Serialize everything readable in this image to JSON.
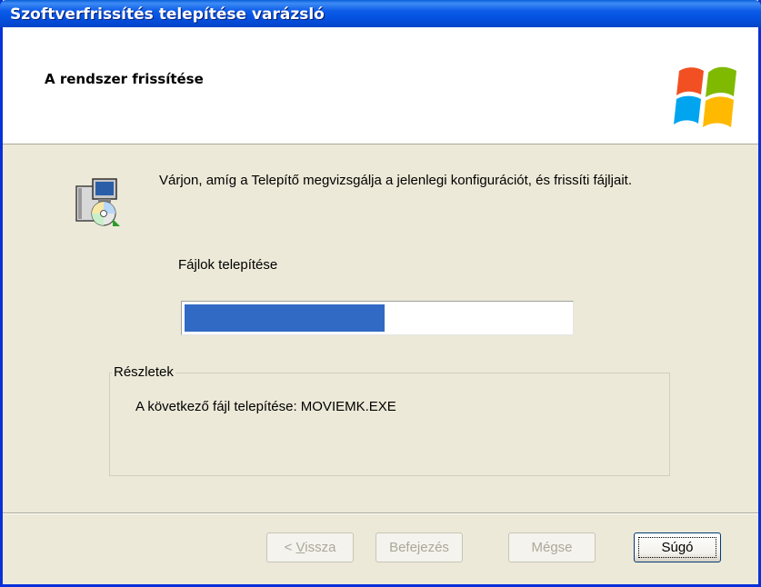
{
  "window": {
    "title": "Szoftverfrissítés telepítése varázsló"
  },
  "header": {
    "title": "A rendszer frissítése",
    "logo": "windows-logo"
  },
  "content": {
    "description": "Várjon, amíg a Telepítő megvizsgálja a jelenlegi konfigurációt, és frissíti fájljait.",
    "status": "Fájlok telepítése",
    "progress_fraction": 0.52,
    "details_legend": "Részletek",
    "details_text": "A következő fájl telepítése: MOVIEMK.EXE"
  },
  "buttons": {
    "back_prefix": "< ",
    "back_mnemonic": "V",
    "back_rest": "issza",
    "finish": "Befejezés",
    "cancel": "Mégse",
    "help": "Súgó"
  },
  "colors": {
    "titlebar": "#0554e3",
    "progress": "#316ac5",
    "dialog_bg": "#ece9d8"
  }
}
